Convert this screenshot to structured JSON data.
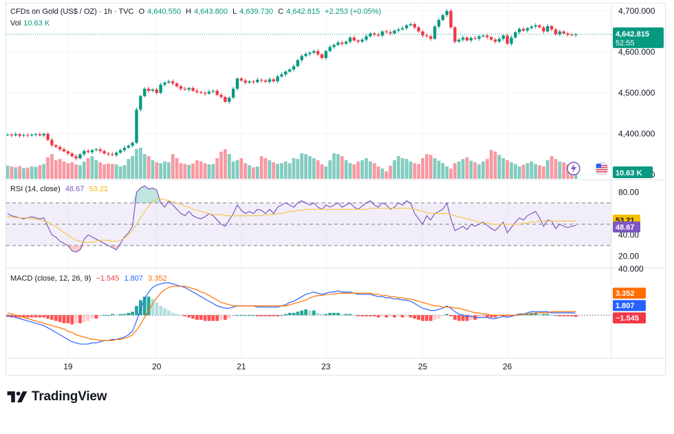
{
  "header": {
    "symbol": "CFDs on Gold (US$ / OZ) · 1h · TVC",
    "open_label": "O",
    "open": "4,640.550",
    "high_label": "H",
    "high": "4,643.800",
    "low_label": "L",
    "low": "4,639.730",
    "close_label": "C",
    "close": "4,642.815",
    "change": "+2.253 (+0.05%)",
    "vol_label": "Vol",
    "vol": "10.63 K"
  },
  "price_axis": {
    "ticks": [
      "4,700.000",
      "4,600.000",
      "4,500.000",
      "4,400.000",
      "4,300.000"
    ],
    "last_price": "4,642.815",
    "countdown": "52:55",
    "volume_tag": "10.63 K"
  },
  "rsi": {
    "label": "RSI (14, close)",
    "value": "48.67",
    "ma": "53.21",
    "ticks": [
      "80.00",
      "40.00",
      "20.00"
    ]
  },
  "macd": {
    "label": "MACD (close, 12, 26, 9)",
    "histogram": "−1.545",
    "macd": "1.807",
    "signal": "3.352",
    "ticks": [
      "40.000"
    ]
  },
  "time_axis": {
    "ticks": [
      "19",
      "20",
      "21",
      "23",
      "25",
      "26"
    ]
  },
  "brand": {
    "name": "TradingView"
  },
  "colors": {
    "up": "#089981",
    "down": "#f23645",
    "rsi_line": "#7e57c2",
    "rsi_ma": "#f5c84c",
    "macd_line": "#2962ff",
    "signal_line": "#ff6d00"
  },
  "chart_data": {
    "type": "candlestick",
    "title": "CFDs on Gold (US$ / OZ) · 1h · TVC",
    "x_ticks": [
      "19",
      "20",
      "21",
      "23",
      "25",
      "26"
    ],
    "x_tick_bar_index": [
      15,
      37,
      58,
      79,
      103,
      124
    ],
    "price_ylim": [
      4290,
      4715
    ],
    "price_closes": [
      4398,
      4396,
      4399,
      4395,
      4397,
      4396,
      4398,
      4399,
      4396,
      4400,
      4385,
      4372,
      4368,
      4362,
      4357,
      4352,
      4345,
      4340,
      4350,
      4358,
      4355,
      4360,
      4362,
      4358,
      4352,
      4350,
      4348,
      4354,
      4360,
      4366,
      4371,
      4378,
      4459,
      4492,
      4510,
      4505,
      4508,
      4500,
      4520,
      4525,
      4528,
      4523,
      4516,
      4510,
      4508,
      4512,
      4505,
      4502,
      4500,
      4498,
      4503,
      4505,
      4495,
      4490,
      4478,
      4488,
      4510,
      4535,
      4530,
      4525,
      4528,
      4526,
      4532,
      4530,
      4527,
      4533,
      4528,
      4540,
      4545,
      4552,
      4557,
      4565,
      4580,
      4590,
      4595,
      4598,
      4602,
      4594,
      4585,
      4602,
      4612,
      4617,
      4623,
      4620,
      4625,
      4635,
      4628,
      4625,
      4630,
      4638,
      4645,
      4642,
      4640,
      4650,
      4648,
      4645,
      4652,
      4655,
      4658,
      4665,
      4668,
      4660,
      4650,
      4640,
      4638,
      4632,
      4662,
      4678,
      4690,
      4700,
      4660,
      4625,
      4630,
      4635,
      4628,
      4634,
      4632,
      4638,
      4640,
      4636,
      4630,
      4625,
      4632,
      4640,
      4620,
      4635,
      4648,
      4656,
      4652,
      4658,
      4662,
      4665,
      4660,
      4650,
      4663,
      4655,
      4643,
      4650,
      4645,
      4642,
      4641,
      4643
    ],
    "volume_heights": [
      0.32,
      0.3,
      0.28,
      0.31,
      0.26,
      0.27,
      0.3,
      0.29,
      0.33,
      0.36,
      0.52,
      0.6,
      0.45,
      0.48,
      0.42,
      0.38,
      0.4,
      0.35,
      0.33,
      0.42,
      0.5,
      0.55,
      0.45,
      0.4,
      0.35,
      0.37,
      0.36,
      0.35,
      0.3,
      0.33,
      0.48,
      0.55,
      0.72,
      0.75,
      0.6,
      0.55,
      0.45,
      0.4,
      0.38,
      0.42,
      0.4,
      0.6,
      0.5,
      0.38,
      0.36,
      0.34,
      0.37,
      0.45,
      0.42,
      0.38,
      0.35,
      0.36,
      0.5,
      0.66,
      0.72,
      0.6,
      0.42,
      0.45,
      0.5,
      0.38,
      0.33,
      0.28,
      0.3,
      0.55,
      0.5,
      0.45,
      0.4,
      0.36,
      0.38,
      0.42,
      0.38,
      0.5,
      0.48,
      0.62,
      0.6,
      0.55,
      0.5,
      0.45,
      0.35,
      0.3,
      0.45,
      0.62,
      0.6,
      0.55,
      0.45,
      0.38,
      0.35,
      0.42,
      0.45,
      0.5,
      0.42,
      0.38,
      0.3,
      0.25,
      0.18,
      0.32,
      0.45,
      0.55,
      0.5,
      0.48,
      0.42,
      0.38,
      0.36,
      0.5,
      0.6,
      0.58,
      0.5,
      0.44,
      0.38,
      0.3,
      0.25,
      0.38,
      0.42,
      0.48,
      0.52,
      0.44,
      0.4,
      0.35,
      0.42,
      0.48,
      0.7,
      0.66,
      0.58,
      0.5,
      0.45,
      0.4,
      0.36,
      0.3,
      0.34,
      0.38,
      0.42,
      0.36,
      0.33,
      0.3,
      0.45,
      0.55,
      0.48,
      0.42,
      0.4,
      0.35,
      0.3,
      0.28
    ],
    "rsi_ylim": [
      10,
      90
    ],
    "rsi_bands": [
      70,
      50,
      30
    ],
    "rsi": [
      60,
      58,
      57,
      56,
      55,
      56,
      57,
      56,
      55,
      56,
      48,
      40,
      38,
      34,
      32,
      30,
      25,
      24,
      26,
      36,
      40,
      38,
      36,
      34,
      32,
      30,
      28,
      26,
      32,
      38,
      42,
      48,
      80,
      84,
      86,
      83,
      84,
      82,
      70,
      66,
      72,
      68,
      64,
      60,
      58,
      62,
      58,
      56,
      55,
      57,
      60,
      58,
      54,
      50,
      48,
      54,
      60,
      68,
      63,
      60,
      62,
      60,
      64,
      63,
      60,
      64,
      60,
      66,
      68,
      70,
      68,
      66,
      70,
      72,
      70,
      68,
      70,
      66,
      64,
      68,
      66,
      68,
      70,
      66,
      68,
      70,
      66,
      64,
      67,
      70,
      72,
      68,
      66,
      70,
      68,
      64,
      66,
      70,
      68,
      72,
      70,
      60,
      55,
      50,
      58,
      54,
      60,
      62,
      64,
      70,
      55,
      44,
      46,
      48,
      45,
      50,
      48,
      50,
      52,
      49,
      46,
      44,
      48,
      52,
      42,
      47,
      52,
      56,
      54,
      58,
      60,
      62,
      56,
      48,
      54,
      53,
      46,
      50,
      48,
      47,
      48,
      49
    ],
    "rsi_ma": [
      57,
      57,
      56,
      56,
      56,
      56,
      55,
      55,
      54,
      53,
      52,
      50,
      48,
      45,
      42,
      40,
      37,
      35,
      34,
      33,
      33,
      33,
      34,
      35,
      35,
      35,
      34,
      34,
      35,
      37,
      40,
      44,
      50,
      56,
      62,
      67,
      71,
      73,
      74,
      73,
      72,
      71,
      70,
      69,
      67,
      66,
      64,
      63,
      62,
      61,
      60,
      59,
      59,
      59,
      58,
      58,
      58,
      58,
      58,
      58,
      58,
      58,
      58,
      58,
      59,
      59,
      59,
      60,
      60,
      61,
      62,
      62,
      63,
      63,
      64,
      64,
      64,
      64,
      64,
      64,
      64,
      64,
      64,
      64,
      64,
      64,
      64,
      64,
      64,
      64,
      65,
      65,
      65,
      65,
      65,
      65,
      65,
      65,
      65,
      65,
      65,
      64,
      63,
      62,
      61,
      60,
      60,
      60,
      60,
      60,
      59,
      58,
      57,
      56,
      55,
      54,
      53,
      52,
      51,
      51,
      50,
      50,
      50,
      50,
      50,
      50,
      50,
      50,
      51,
      51,
      52,
      52,
      53,
      53,
      53,
      53,
      53,
      53,
      53,
      53,
      53,
      53
    ],
    "macd_ylim": [
      -35,
      40
    ],
    "macd": [
      0,
      -1,
      -2,
      -3,
      -4,
      -5,
      -6,
      -7,
      -8,
      -9,
      -11,
      -13,
      -15,
      -17,
      -19,
      -21,
      -23,
      -24,
      -25,
      -25,
      -25,
      -24,
      -24,
      -23,
      -22,
      -22,
      -21,
      -21,
      -20,
      -19,
      -17,
      -14,
      -5,
      5,
      14,
      20,
      24,
      26,
      27,
      28,
      28,
      27,
      26,
      25,
      24,
      22,
      20,
      18,
      16,
      14,
      12,
      10,
      8,
      7,
      6,
      6,
      7,
      8,
      8,
      8,
      8,
      8,
      7,
      7,
      7,
      7,
      7,
      7,
      8,
      9,
      11,
      12,
      14,
      16,
      18,
      19,
      20,
      19,
      18,
      19,
      20,
      20,
      21,
      20,
      20,
      20,
      19,
      18,
      18,
      18,
      18,
      17,
      16,
      16,
      15,
      15,
      14,
      14,
      13,
      13,
      12,
      10,
      8,
      6,
      5,
      4,
      4,
      5,
      6,
      8,
      6,
      3,
      1,
      0,
      -1,
      -1,
      -2,
      -2,
      -2,
      -2,
      -3,
      -3,
      -2,
      -1,
      -2,
      -1,
      0,
      1,
      1,
      2,
      3,
      3,
      3,
      3,
      3,
      2,
      2,
      2,
      2,
      2,
      2,
      1.8
    ],
    "signal": [
      2,
      1,
      0,
      -1,
      -2,
      -3,
      -4,
      -5,
      -6,
      -7,
      -8,
      -9,
      -10,
      -11,
      -12,
      -14,
      -15,
      -17,
      -18,
      -19,
      -20,
      -21,
      -21,
      -22,
      -22,
      -22,
      -22,
      -21,
      -21,
      -20,
      -19,
      -17,
      -13,
      -8,
      -2,
      4,
      10,
      15,
      19,
      22,
      24,
      25,
      25,
      25,
      25,
      24,
      23,
      22,
      20,
      19,
      17,
      15,
      13,
      11,
      10,
      9,
      8,
      8,
      8,
      8,
      8,
      8,
      8,
      8,
      8,
      8,
      8,
      8,
      8,
      8,
      9,
      10,
      11,
      12,
      13,
      15,
      16,
      17,
      17,
      18,
      18,
      18,
      19,
      19,
      19,
      19,
      19,
      19,
      19,
      19,
      19,
      18,
      18,
      17,
      17,
      16,
      16,
      15,
      15,
      14,
      14,
      13,
      12,
      11,
      10,
      9,
      8,
      8,
      7,
      7,
      7,
      6,
      6,
      5,
      4,
      3,
      2,
      2,
      1,
      1,
      0,
      0,
      0,
      0,
      0,
      0,
      0,
      0,
      1,
      1,
      1,
      2,
      2,
      2,
      2,
      3,
      3,
      3,
      3,
      3,
      3,
      3.4
    ],
    "macd_hist": [
      -1.5,
      -2,
      -2,
      -2,
      -2,
      -2,
      -2,
      -2,
      -2,
      -2,
      -3,
      -4,
      -5,
      -6,
      -7,
      -7,
      -8,
      -7,
      -7,
      -6,
      -5,
      -3,
      -3,
      -1,
      0,
      0,
      1,
      0,
      1,
      1,
      2,
      3,
      8,
      13,
      16,
      16,
      14,
      11,
      8,
      6,
      4,
      2,
      1,
      0,
      -1,
      -2,
      -3,
      -4,
      -4,
      -5,
      -5,
      -5,
      -5,
      -4,
      -4,
      -3,
      -1,
      0,
      0,
      0,
      0,
      0,
      -1,
      -1,
      -1,
      -1,
      -1,
      -1,
      0,
      1,
      2,
      2,
      3,
      4,
      5,
      4,
      4,
      2,
      1,
      1,
      2,
      2,
      2,
      1,
      1,
      1,
      0,
      -1,
      -1,
      -1,
      -1,
      -1,
      -2,
      -1,
      -2,
      -1,
      -2,
      -1,
      -2,
      -1,
      -2,
      -3,
      -4,
      -5,
      -5,
      -5,
      -4,
      -3,
      -1,
      1,
      -1,
      -4,
      -5,
      -5,
      -5,
      -4,
      -4,
      -3,
      -2,
      -2,
      -2,
      -2,
      -1,
      -1,
      -1,
      -1,
      0,
      1,
      1,
      1,
      2,
      2,
      1,
      1,
      1,
      0,
      0,
      -1,
      -1,
      -1,
      -1,
      -1.5
    ]
  }
}
